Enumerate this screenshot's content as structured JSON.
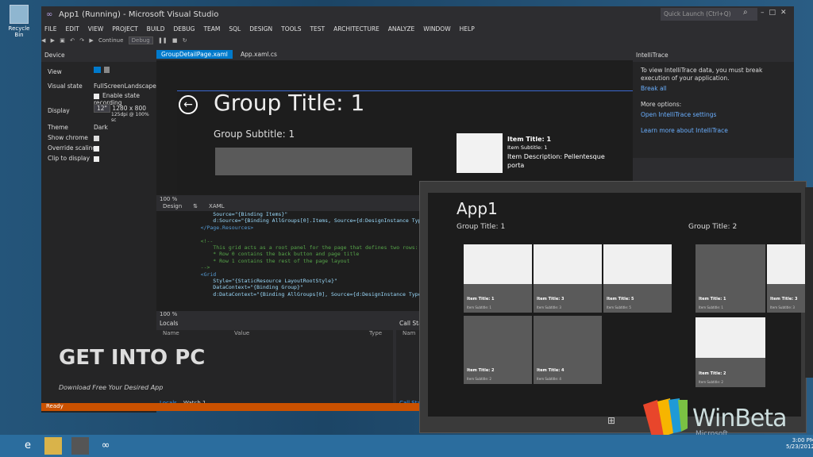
{
  "desktop": {
    "recycle_label": "Recycle Bin"
  },
  "window": {
    "title": "App1 (Running) - Microsoft Visual Studio",
    "quick_launch": "Quick Launch (Ctrl+Q)"
  },
  "menu": [
    "FILE",
    "EDIT",
    "VIEW",
    "PROJECT",
    "BUILD",
    "DEBUG",
    "TEAM",
    "SQL",
    "DESIGN",
    "TOOLS",
    "TEST",
    "ARCHITECTURE",
    "ANALYZE",
    "WINDOW",
    "HELP"
  ],
  "toolbar": {
    "continue_label": "Continue",
    "config": "Debug"
  },
  "device": {
    "title": "Device",
    "view_label": "View",
    "visual_state_label": "Visual state",
    "visual_state": "FullScreenLandscape",
    "enable_state": "Enable state recording",
    "display_label": "Display",
    "display_size": "12\"",
    "display_res": "1280 x 800",
    "display_dpi": "125dpi @ 100% sc",
    "theme_label": "Theme",
    "theme": "Dark",
    "show_chrome": "Show chrome",
    "override_scaling": "Override scaling",
    "clip_to_display": "Clip to display"
  },
  "tabs": {
    "active": "GroupDetailPage.xaml",
    "second": "App.xaml.cs"
  },
  "designer": {
    "group_title": "Group Title: 1",
    "group_subtitle": "Group Subtitle: 1",
    "item_title": "Item Title: 1",
    "item_subtitle": "Item Subtitle: 1",
    "item_desc": "Item Description: Pellentesque porta"
  },
  "editor": {
    "zoom": "100 %",
    "design_tab": "Design",
    "xaml_tab": "XAML",
    "lines": [
      "        Source=\"{Binding Items}\"",
      "        d:Source=\"{Binding AllGroups[0].Items, Source={d:DesignInstance Type=",
      "    </Page.Resources>",
      "",
      "    <!--",
      "        This grid acts as a root panel for the page that defines two rows:",
      "        * Row 0 contains the back button and page title",
      "        * Row 1 contains the rest of the page layout",
      "    -->",
      "    <Grid",
      "        Style=\"{StaticResource LayoutRootStyle}\"",
      "        DataContext=\"{Binding Group}\"",
      "        d:DataContext=\"{Binding AllGroups[0], Source={d:DesignInstance Type=data"
    ]
  },
  "locals": {
    "title": "Locals",
    "col_name": "Name",
    "col_value": "Value",
    "col_type": "Type",
    "tab_locals": "Locals",
    "tab_watch": "Watch 1"
  },
  "callstack": {
    "title": "Call Stack",
    "col_name": "Nam",
    "tab": "Call Stac"
  },
  "intellitrace": {
    "title": "IntelliTrace",
    "message": "To view IntelliTrace data, you must break execution of your application.",
    "break_all": "Break all",
    "more_options": "More options:",
    "open_settings": "Open IntelliTrace settings",
    "learn_more": "Learn more about IntelliTrace"
  },
  "status": "Ready",
  "watermark": {
    "main": "GET INTO PC",
    "sub": "Download Free Your Desired App"
  },
  "app": {
    "title": "App1",
    "group1": "Group Title: 1",
    "group2": "Group Title: 2",
    "tiles": [
      {
        "title": "Item Title: 1",
        "sub": "Item Subtitle: 1"
      },
      {
        "title": "Item Title: 3",
        "sub": "Item Subtitle: 3"
      },
      {
        "title": "Item Title: 5",
        "sub": "Item Subtitle: 5"
      },
      {
        "title": "Item Title: 2",
        "sub": "Item Subtitle: 2"
      },
      {
        "title": "Item Title: 4",
        "sub": "Item Subtitle: 4"
      },
      {
        "title": "Item Title: 1",
        "sub": "Item Subtitle: 1"
      },
      {
        "title": "Item Title: 3",
        "sub": "Item Subtitle: 3"
      },
      {
        "title": "Item Title: 2",
        "sub": "Item Subtitle: 2"
      }
    ]
  },
  "branding": {
    "winbeta": "WinBeta",
    "winbeta_sub": "Microsoft"
  },
  "clock": {
    "time": "3:00 PM",
    "date": "5/23/2012"
  }
}
